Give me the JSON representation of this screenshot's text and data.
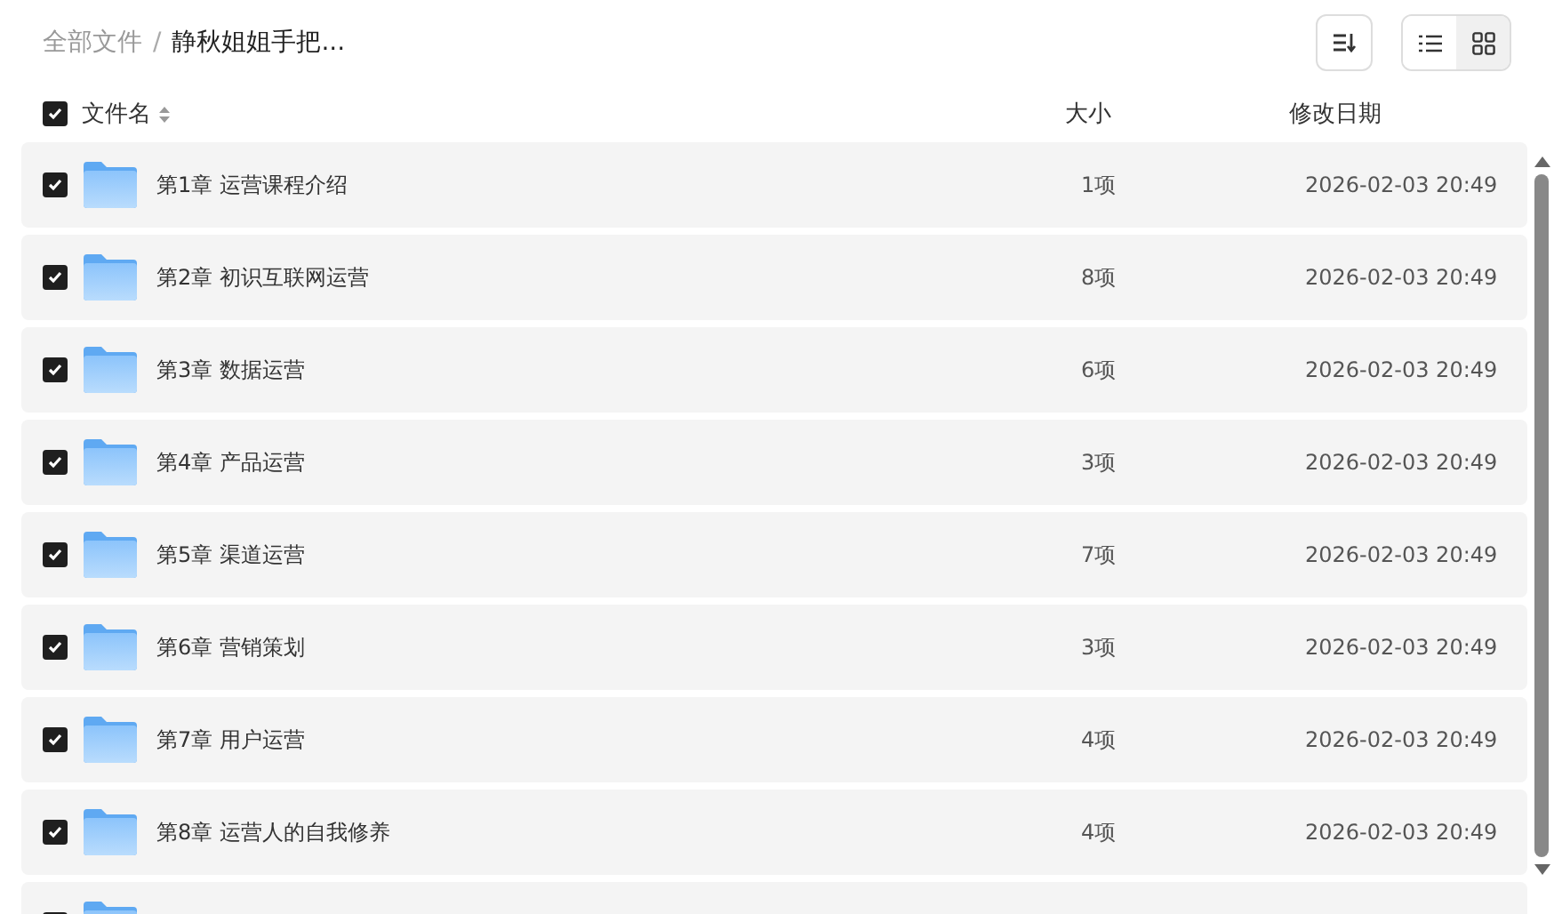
{
  "breadcrumb_separator": "/",
  "breadcrumb": [
    {
      "label": "全部文件",
      "current": false
    },
    {
      "label": "静秋姐姐手把...",
      "current": true
    }
  ],
  "view_modes": [
    {
      "kind": "list",
      "selected": true
    },
    {
      "kind": "grid",
      "selected": false
    }
  ],
  "header": {
    "checked": true,
    "name": "文件名",
    "size": "大小",
    "date": "修改日期"
  },
  "rows": [
    {
      "checked": true,
      "name": "第1章 运营课程介绍",
      "size": "1项",
      "date": "2026-02-03 20:49"
    },
    {
      "checked": true,
      "name": "第2章 初识互联网运营",
      "size": "8项",
      "date": "2026-02-03 20:49"
    },
    {
      "checked": true,
      "name": "第3章 数据运营",
      "size": "6项",
      "date": "2026-02-03 20:49"
    },
    {
      "checked": true,
      "name": "第4章 产品运营",
      "size": "3项",
      "date": "2026-02-03 20:49"
    },
    {
      "checked": true,
      "name": "第5章 渠道运营",
      "size": "7项",
      "date": "2026-02-03 20:49"
    },
    {
      "checked": true,
      "name": "第6章 营销策划",
      "size": "3项",
      "date": "2026-02-03 20:49"
    },
    {
      "checked": true,
      "name": "第7章 用户运营",
      "size": "4项",
      "date": "2026-02-03 20:49"
    },
    {
      "checked": true,
      "name": "第8章 运营人的自我修养",
      "size": "4项",
      "date": "2026-02-03 20:49"
    },
    {
      "checked": true
    }
  ]
}
